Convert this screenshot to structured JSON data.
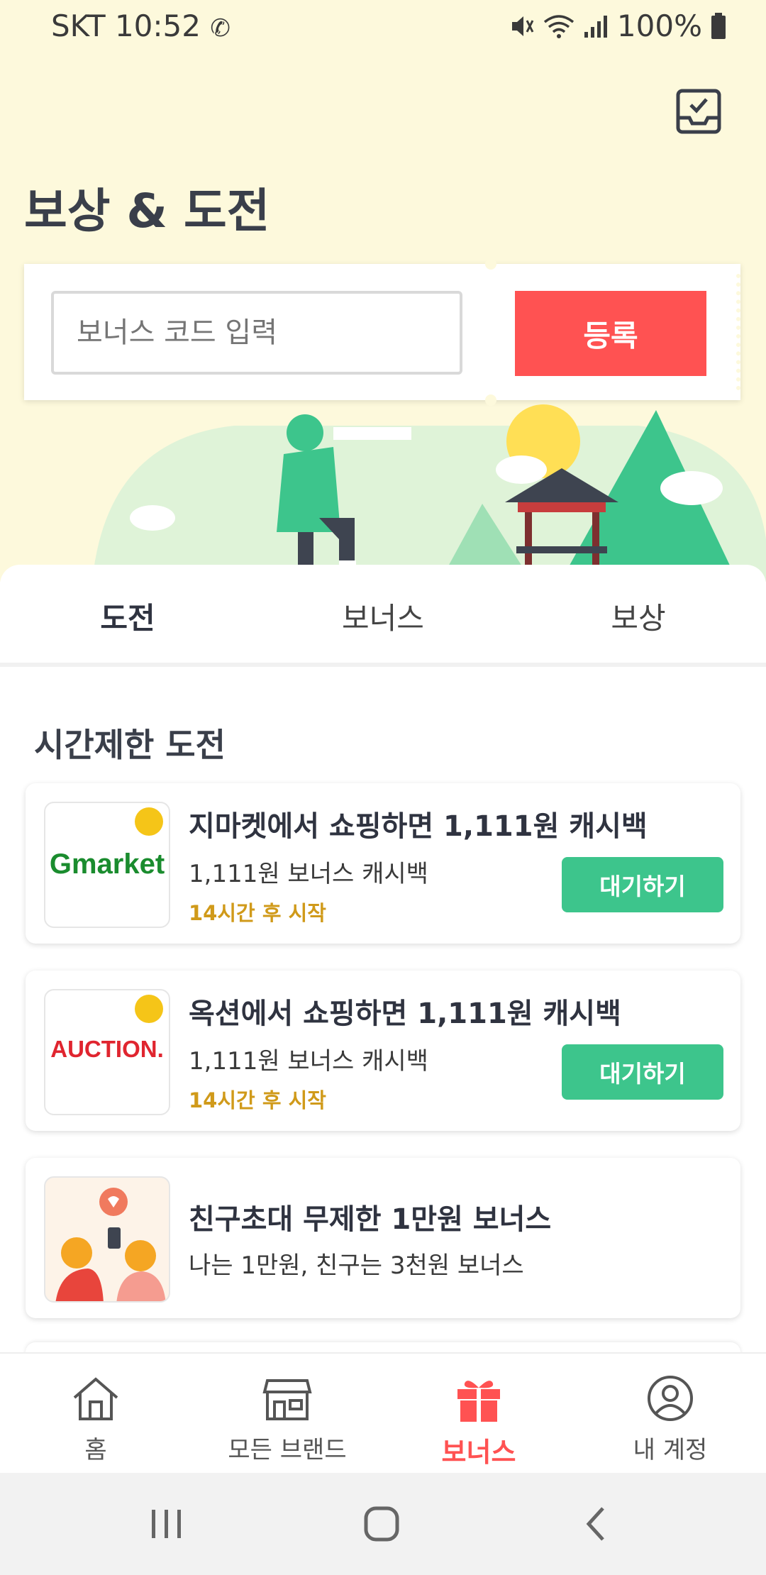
{
  "status_bar": {
    "carrier_time": "SKT 10:52",
    "battery": "100%"
  },
  "header": {
    "title": "보상 & 도전"
  },
  "coupon": {
    "placeholder": "보너스 코드 입력",
    "register_label": "등록"
  },
  "tabs": [
    {
      "label": "도전",
      "active": true
    },
    {
      "label": "보너스",
      "active": false
    },
    {
      "label": "보상",
      "active": false
    }
  ],
  "section": {
    "title": "시간제한 도전"
  },
  "cards": [
    {
      "logo": "Gmarket",
      "badge": "Big",
      "title": "지마켓에서 쇼핑하면 1,111원 캐시백",
      "subtitle": "1,111원 보너스 캐시백",
      "time": "14시간 후 시작",
      "button": "대기하기"
    },
    {
      "logo": "AUCTION.",
      "badge": "Big",
      "title": "옥션에서 쇼핑하면 1,111원 캐시백",
      "subtitle": "1,111원 보너스 캐시백",
      "time": "14시간 후 시작",
      "button": "대기하기"
    },
    {
      "title": "친구초대 무제한 1만원 보너스",
      "subtitle": "나는 1만원, 친구는 3천원 보너스"
    }
  ],
  "bottom_nav": [
    {
      "label": "홈",
      "icon": "home-icon"
    },
    {
      "label": "모든 브랜드",
      "icon": "store-icon"
    },
    {
      "label": "보너스",
      "icon": "gift-icon",
      "active": true
    },
    {
      "label": "내 계정",
      "icon": "account-icon"
    }
  ],
  "colors": {
    "accent": "#ff5252",
    "green": "#3dc58c",
    "hero_bg": "#fdf9dc",
    "time_text": "#d09a1a"
  }
}
